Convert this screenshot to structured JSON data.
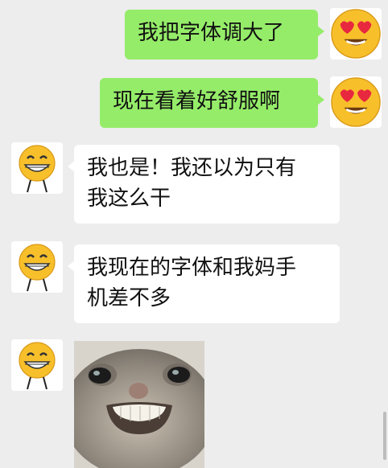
{
  "messages": [
    {
      "side": "mine",
      "text": "我把字体调大了",
      "avatar_icon": "heart-eyes-emoji-icon"
    },
    {
      "side": "mine",
      "text": "现在看着好舒服啊",
      "avatar_icon": "heart-eyes-emoji-icon"
    },
    {
      "side": "theirs",
      "line1": "我也是！我还以为只有",
      "line2": "我这么干",
      "avatar_icon": "grinning-emoji-icon"
    },
    {
      "side": "theirs",
      "line1": "我现在的字体和我妈手",
      "line2": "机差不多",
      "avatar_icon": "grinning-emoji-icon"
    },
    {
      "side": "theirs",
      "type": "sticker",
      "sticker_icon": "grinning-cat-sticker-icon",
      "avatar_icon": "grinning-emoji-icon"
    }
  ],
  "colors": {
    "background": "#ededed",
    "mine_bubble": "#95ec69",
    "theirs_bubble": "#ffffff"
  }
}
